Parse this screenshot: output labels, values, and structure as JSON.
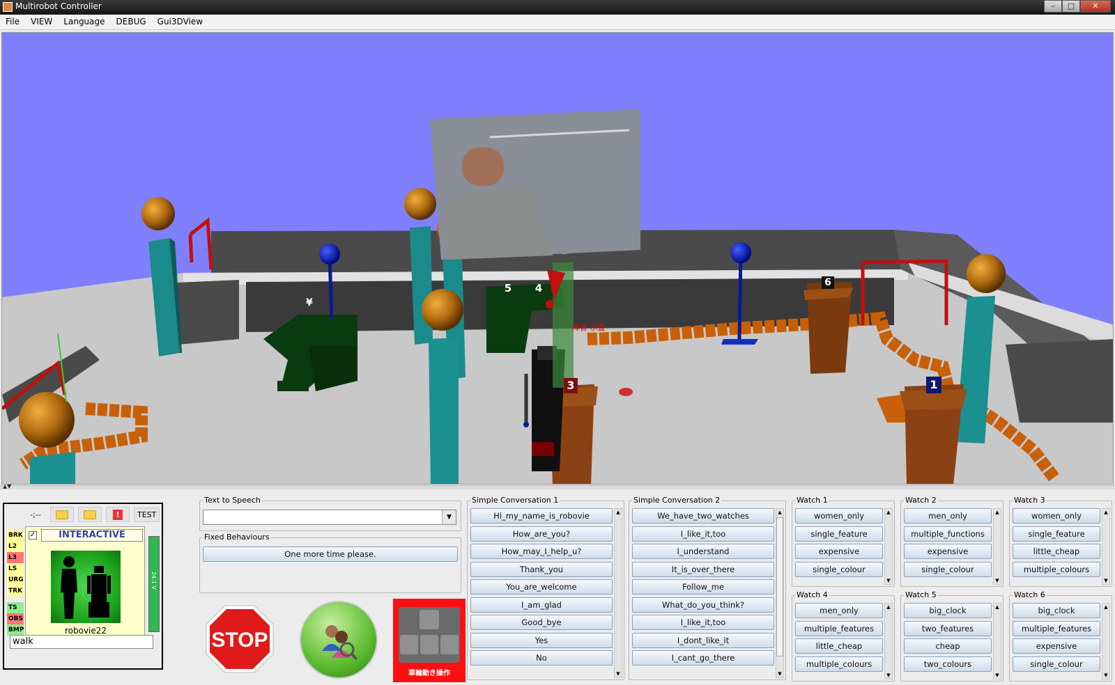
{
  "window": {
    "title": "Multirobot Controller",
    "controls": [
      "minimize",
      "maximize",
      "close"
    ]
  },
  "menubar": [
    "File",
    "VIEW",
    "Language",
    "DEBUG",
    "Gui3DView"
  ],
  "scene": {
    "markers": [
      "1",
      "3",
      "4",
      "5",
      "6"
    ],
    "yen_sign": "¥",
    "red_label": "障害 示査"
  },
  "robot_panel": {
    "dash_label": "-;--",
    "test_label": "TEST",
    "status_indicators": [
      {
        "label": "BRK",
        "color": "#ffff99"
      },
      {
        "label": "L2",
        "color": "#ffff99"
      },
      {
        "label": "L3",
        "color": "#ff7777"
      },
      {
        "label": "LS",
        "color": "#ffff99"
      },
      {
        "label": "URG",
        "color": "#ffff99"
      },
      {
        "label": "TRK",
        "color": "#ffff99"
      },
      {
        "label": "TS",
        "color": "#90ee90"
      },
      {
        "label": "OBS",
        "color": "#ff7777"
      },
      {
        "label": "BMP",
        "color": "#90ee90"
      }
    ],
    "checkbox_checked": true,
    "mode": "INTERACTIVE",
    "robot_name": "robovie22",
    "battery": "24.1 V",
    "command_input": "walk"
  },
  "tts": {
    "title": "Text to Speech",
    "value": ""
  },
  "fixed_behaviours": {
    "title": "Fixed Behaviours",
    "buttons": [
      "One more time please."
    ]
  },
  "stop_label": "STOP",
  "key_label": "車輪動き操作",
  "simple_conv_1": {
    "title": "Simple Conversation 1",
    "buttons": [
      "Hi_my_name_is_robovie",
      "How_are_you?",
      "How_may_I_help_u?",
      "Thank_you",
      "You_are_welcome",
      "I_am_glad",
      "Good_bye",
      "Yes",
      "No"
    ]
  },
  "simple_conv_2": {
    "title": "Simple Conversation 2",
    "buttons": [
      "We_have_two_watches",
      "I_like_it,too",
      "I_understand",
      "It_is_over_there",
      "Follow_me",
      "What_do_you_think?",
      "I_like_it,too",
      "I_dont_like_it",
      "I_cant_go_there"
    ]
  },
  "watches": [
    {
      "title": "Watch 1",
      "buttons": [
        "women_only",
        "single_feature",
        "expensive",
        "single_colour"
      ]
    },
    {
      "title": "Watch 2",
      "buttons": [
        "men_only",
        "multiple_functions",
        "expensive",
        "single_colour"
      ]
    },
    {
      "title": "Watch 3",
      "buttons": [
        "women_only",
        "single_feature",
        "little_cheap",
        "multiple_colours"
      ]
    },
    {
      "title": "Watch 4",
      "buttons": [
        "men_only",
        "multiple_features",
        "little_cheap",
        "multiple_colours"
      ]
    },
    {
      "title": "Watch 5",
      "buttons": [
        "big_clock",
        "two_features",
        "cheap",
        "two_colours"
      ]
    },
    {
      "title": "Watch 6",
      "buttons": [
        "big_clock",
        "multiple_features",
        "expensive",
        "single_colour"
      ]
    }
  ]
}
